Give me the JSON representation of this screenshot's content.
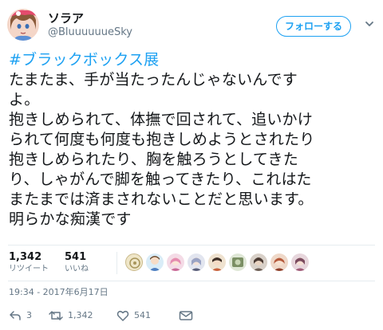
{
  "user": {
    "display_name": "ソラア",
    "screen_name": "@BluuuuuueSky",
    "avatar_icon": "user-avatar"
  },
  "header": {
    "follow_label": "フォローする",
    "caret_icon": "chevron-down-icon"
  },
  "tweet": {
    "hashtag": "#ブラックボックス展",
    "lines": [
      "たまたま、手が当たったんじゃないんです",
      "よ。",
      "抱きしめられて、体撫で回されて、追いかけ",
      "られて何度も何度も抱きしめようとされたり",
      "抱きしめられたり、胸を触ろうとしてきた",
      "り、しゃがんで脚を触ってきたり、これはた",
      "またまでは済まされないことだと思います。",
      "明らかな痴漢です"
    ]
  },
  "stats": {
    "retweets": {
      "count": "1,342",
      "label": "リツイート"
    },
    "likes": {
      "count": "541",
      "label": "いいね"
    },
    "likers_count_shown": 9
  },
  "timestamp": "19:34 - 2017年6月17日",
  "actions": {
    "reply": {
      "icon": "reply-icon",
      "count": "3"
    },
    "retweet": {
      "icon": "retweet-icon",
      "count": "1,342"
    },
    "like": {
      "icon": "heart-icon",
      "count": "541"
    },
    "share": {
      "icon": "mail-icon"
    }
  },
  "colors": {
    "accent": "#1da1f2",
    "text": "#14171a",
    "secondary_text": "#657786",
    "divider": "#e6ecf0"
  }
}
